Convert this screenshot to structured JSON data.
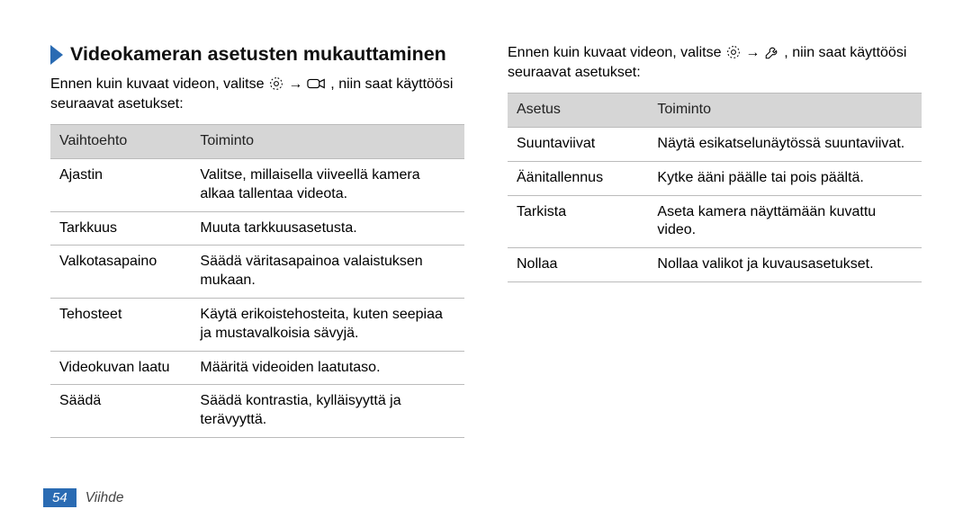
{
  "heading": "Videokameran asetusten mukauttaminen",
  "left": {
    "intro_before": "Ennen kuin kuvaat videon, valitse ",
    "intro_arrow": " → ",
    "intro_after": ", niin saat käyttöösi seuraavat asetukset:",
    "headers": {
      "col1": "Vaihtoehto",
      "col2": "Toiminto"
    },
    "rows": [
      {
        "c1": "Ajastin",
        "c2": "Valitse, millaisella viiveellä kamera alkaa tallentaa videota."
      },
      {
        "c1": "Tarkkuus",
        "c2": "Muuta tarkkuusasetusta."
      },
      {
        "c1": "Valkotasapaino",
        "c2": "Säädä väritasapainoa valaistuksen mukaan."
      },
      {
        "c1": "Tehosteet",
        "c2": "Käytä erikoistehosteita, kuten seepiaa ja mustavalkoisia sävyjä."
      },
      {
        "c1": "Videokuvan laatu",
        "c2": "Määritä videoiden laatutaso."
      },
      {
        "c1": "Säädä",
        "c2": "Säädä kontrastia, kylläisyyttä ja terävyyttä."
      }
    ]
  },
  "right": {
    "intro_before": "Ennen kuin kuvaat videon, valitse ",
    "intro_arrow": " → ",
    "intro_after": ", niin saat käyttöösi seuraavat asetukset:",
    "headers": {
      "col1": "Asetus",
      "col2": "Toiminto"
    },
    "rows": [
      {
        "c1": "Suuntaviivat",
        "c2": "Näytä esikatselunäytössä suuntaviivat."
      },
      {
        "c1": "Äänitallennus",
        "c2": "Kytke ääni päälle tai pois päältä."
      },
      {
        "c1": "Tarkista",
        "c2": "Aseta kamera näyttämään kuvattu video."
      },
      {
        "c1": "Nollaa",
        "c2": "Nollaa valikot ja kuvausasetukset."
      }
    ]
  },
  "footer": {
    "page": "54",
    "section": "Viihde"
  }
}
